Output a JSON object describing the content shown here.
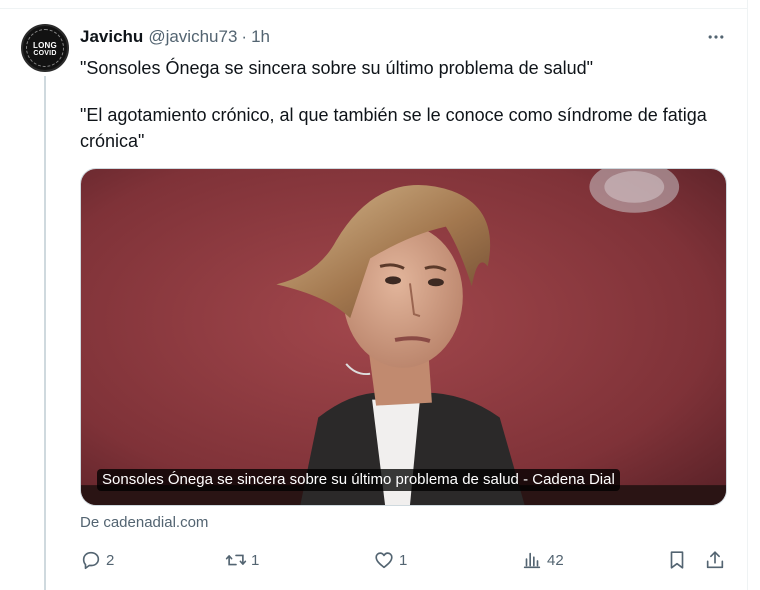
{
  "tweet": {
    "author_name": "Javichu",
    "author_handle": "@javichu73",
    "separator": "·",
    "time": "1h",
    "avatar": {
      "line1": "LONG",
      "line2": "COVID"
    },
    "text_line1": "\"Sonsoles Ónega se sincera sobre su último problema de salud\"",
    "text_line2": "\"El agotamiento crónico, al que también se le conoce como síndrome de fatiga crónica\"",
    "more_icon": "more-horizontal-icon"
  },
  "card": {
    "caption": "Sonsoles Ónega se sincera sobre su último problema de salud - Cadena Dial",
    "source": "De cadenadial.com"
  },
  "actions": {
    "reply_count": "2",
    "retweet_count": "1",
    "like_count": "1",
    "views_count": "42",
    "icons": [
      "reply-icon",
      "retweet-icon",
      "like-icon",
      "views-icon",
      "bookmark-icon",
      "share-icon"
    ]
  },
  "colors": {
    "text_primary": "#0f1419",
    "text_secondary": "#536471",
    "thread_line": "#cfd9de",
    "card_background": "#8d3a40"
  }
}
